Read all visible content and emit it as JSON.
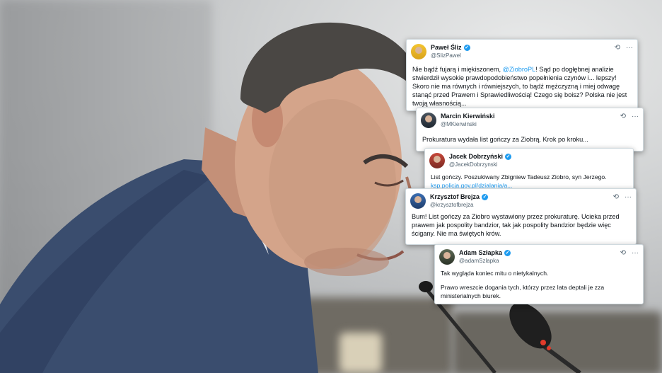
{
  "tweets": [
    {
      "name": "Paweł Śliz",
      "handle": "@SlizPawel",
      "body_pre": "Nie bądź fujarą i miękiszonem, ",
      "mention": "@ZiobroPL",
      "body_post": "! Sąd po dogłębnej analizie stwierdził wysokie prawdopodobieństwo popełnienia czynów i... lepszy! Skoro nie ma równych i równiejszych, to bądź mężczyzną i miej odwagę stanąć przed Prawem i Sprawiedliwością! Czego się boisz? Polska nie jest twoją własnością..."
    },
    {
      "name": "Marcin Kierwiński",
      "handle": "@MKierwinski",
      "body": "Prokuratura wydała list gończy za Ziobrą. Krok po kroku..."
    },
    {
      "name": "Jacek Dobrzyński",
      "handle": "@JacekDobrzynski",
      "body": "List gończy. Poszukiwany Zbigniew Tadeusz Ziobro, syn Jerzego.",
      "link": "ksp.policja.gov.pl/dzialania/a..."
    },
    {
      "name": "Krzysztof Brejza",
      "handle": "@krzysztofbrejza",
      "body": "Bum! List gończy za Ziobro wystawiony przez prokuraturę. Ucieka przed prawem jak pospolity bandzior, tak jak pospolity bandzior będzie więc ścigany. Nie ma świętych krów."
    },
    {
      "name": "Adam Szłapka",
      "handle": "@adamSzlapka",
      "body_line1": "Tak wygląda koniec mitu o nietykalnych.",
      "body_line2": "Prawo wreszcie dogania tych, którzy przez lata deptali je zza ministerialnych biurek."
    }
  ],
  "icons": {
    "verified": "✓",
    "grok": "⟲",
    "more": "···"
  },
  "colors": {
    "link": "#1d9bf0",
    "verified": "#1d9bf0"
  }
}
